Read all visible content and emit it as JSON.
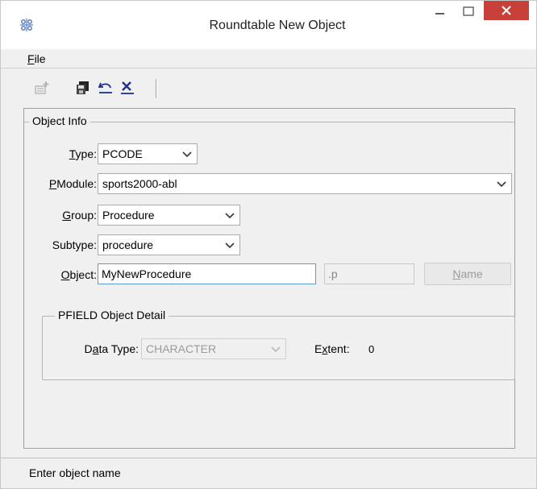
{
  "window": {
    "title": "Roundtable New Object"
  },
  "menu": {
    "file": {
      "accel": "F",
      "rest": "ile"
    }
  },
  "toolbar": {
    "icons": [
      "new-object-icon",
      "save-icon",
      "undo-icon",
      "delete-icon"
    ]
  },
  "object_info": {
    "legend": "Object Info",
    "type": {
      "accel": "T",
      "rest": "ype:",
      "value": "PCODE"
    },
    "pmodule": {
      "accel": "P",
      "rest": "Module:",
      "value": "sports2000-abl"
    },
    "group": {
      "accel": "G",
      "rest": "roup:",
      "value": "Procedure"
    },
    "subtype": {
      "label": "Subtype:",
      "value": "procedure"
    },
    "object": {
      "accel": "O",
      "rest": "bject:",
      "value": "MyNewProcedure",
      "extension": ".p"
    },
    "name_button": {
      "accel": "N",
      "rest": "ame"
    }
  },
  "pfield_detail": {
    "legend": "PFIELD Object Detail",
    "data_type": {
      "pre": "D",
      "accel": "a",
      "rest": "ta Type:",
      "value": "CHARACTER"
    },
    "extent": {
      "pre": "E",
      "accel": "x",
      "rest": "tent:",
      "value": "0"
    }
  },
  "status": {
    "text": "Enter object name"
  },
  "colors": {
    "close_button": "#c7413a",
    "input_focus_border": "#5a9ad6"
  }
}
